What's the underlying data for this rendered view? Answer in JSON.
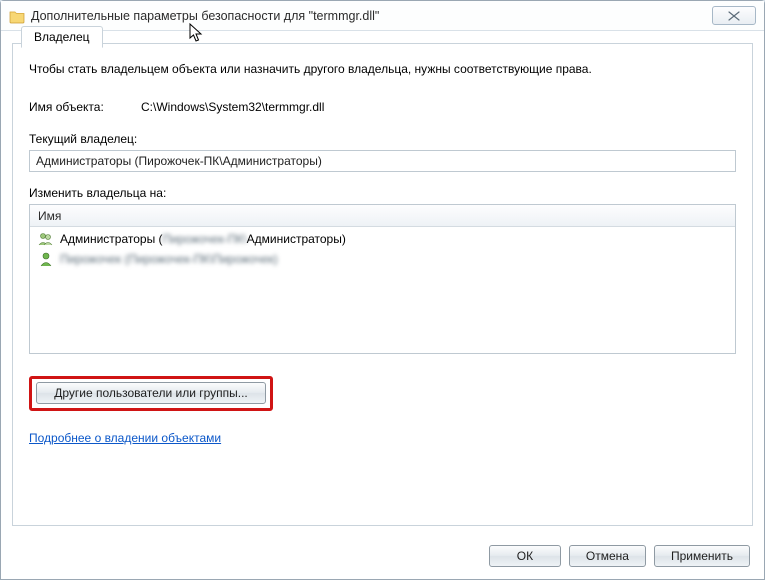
{
  "window": {
    "title": "Дополнительные параметры безопасности  для \"termmgr.dll\""
  },
  "tab": {
    "owner_label": "Владелец"
  },
  "content": {
    "intro": "Чтобы стать владельцем объекта или назначить другого владельца, нужны соответствующие права.",
    "object_name_label": "Имя объекта:",
    "object_name_value": "C:\\Windows\\System32\\termmgr.dll",
    "current_owner_label": "Текущий владелец:",
    "current_owner_value": "Администраторы (Пирожочек-ПК\\Администраторы)",
    "change_owner_label": "Изменить владельца на:",
    "list_header": "Имя",
    "list_items": [
      {
        "text_prefix": "Администраторы (",
        "text_blurred": "Пирожочек-ПК\\",
        "text_suffix": "Администраторы)",
        "icon": "group"
      },
      {
        "text_prefix": "",
        "text_blurred": "Пирожочек (Пирожочек-ПК\\Пирожочек)",
        "text_suffix": "",
        "icon": "user"
      }
    ],
    "other_users_button": "Другие пользователи или группы...",
    "learn_more_link": "Подробнее о владении объектами"
  },
  "buttons": {
    "ok": "ОК",
    "cancel": "Отмена",
    "apply": "Применить"
  }
}
